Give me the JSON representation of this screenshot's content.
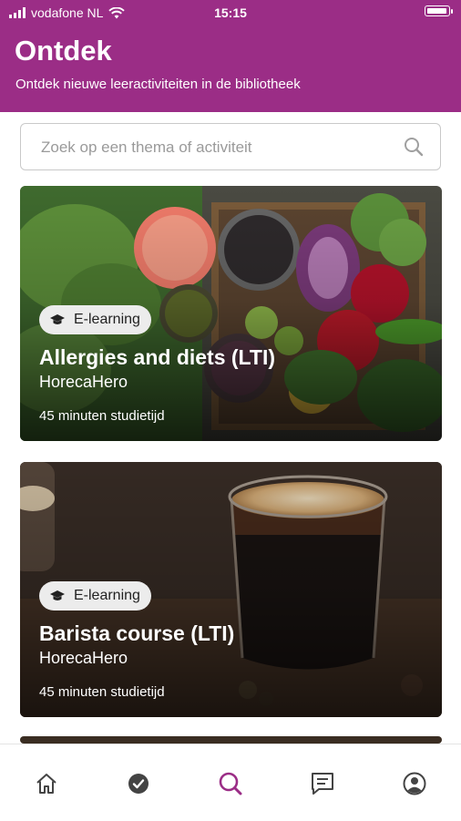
{
  "status_bar": {
    "carrier": "vodafone NL",
    "time": "15:15",
    "battery_level": 0.9
  },
  "header": {
    "title": "Ontdek",
    "subtitle": "Ontdek nieuwe leeractiviteiten in de bibliotheek",
    "background_color": "#9b2d86"
  },
  "search": {
    "placeholder": "Zoek op een thema of activiteit",
    "value": "",
    "icon": "search-icon"
  },
  "cards": [
    {
      "badge": "E-learning",
      "badge_icon": "graduation-cap-icon",
      "title": "Allergies and diets (LTI)",
      "provider": "HorecaHero",
      "duration": "45 minuten studietijd",
      "image": "fresh-vegetables-photo"
    },
    {
      "badge": "E-learning",
      "badge_icon": "graduation-cap-icon",
      "title": "Barista course (LTI)",
      "provider": "HorecaHero",
      "duration": "45 minuten studietijd",
      "image": "espresso-glass-photo"
    }
  ],
  "bottom_nav": {
    "items": [
      {
        "icon": "home-icon",
        "active": false
      },
      {
        "icon": "check-circle-icon",
        "active": false
      },
      {
        "icon": "search-icon",
        "active": true
      },
      {
        "icon": "chat-icon",
        "active": false
      },
      {
        "icon": "profile-icon",
        "active": false
      }
    ],
    "active_color": "#9b2d86",
    "inactive_color": "#444444"
  }
}
